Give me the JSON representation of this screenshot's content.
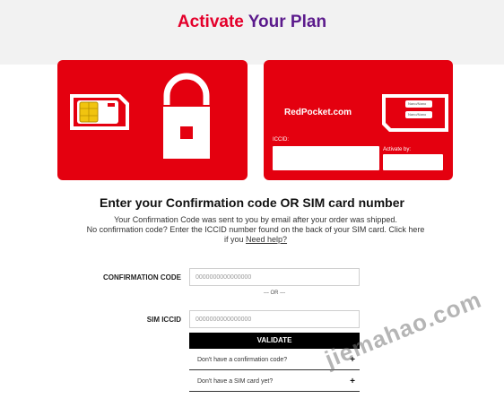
{
  "header": {
    "title_part1": "Activate",
    "title_part2": "Your Plan"
  },
  "colors": {
    "brand_red": "#e4000f",
    "title_red": "#e4002b",
    "title_purple": "#5b1a8c",
    "button_black": "#000000"
  },
  "sim_card": {
    "brand": "RedPocket.com",
    "iccid_label": "ICCID:",
    "activate_label": "Activate by:",
    "chip_labels": [
      "Nano/Nano",
      "Nano/Nano"
    ]
  },
  "icons": [
    "sim-card-icon",
    "padlock-icon"
  ],
  "instructions": {
    "heading": "Enter your Confirmation code OR SIM card number",
    "line1": "Your Confirmation Code was sent to you by email after your order was shipped.",
    "line2": "No confirmation code? Enter the ICCID number found on the back of your SIM card. Click here",
    "line3_prefix": "if you ",
    "help_link": "Need help?"
  },
  "form": {
    "confirmation_label": "CONFIRMATION CODE",
    "confirmation_placeholder": "0000000000000000",
    "or_text": "--- OR ---",
    "sim_label": "SIM ICCID",
    "sim_placeholder": "0000000000000000",
    "validate_label": "VALIDATE"
  },
  "accordion": [
    {
      "label": "Don't have a confirmation code?",
      "icon": "+"
    },
    {
      "label": "Don't have a SIM card yet?",
      "icon": "+"
    }
  ],
  "watermark": "jiemahao.com"
}
